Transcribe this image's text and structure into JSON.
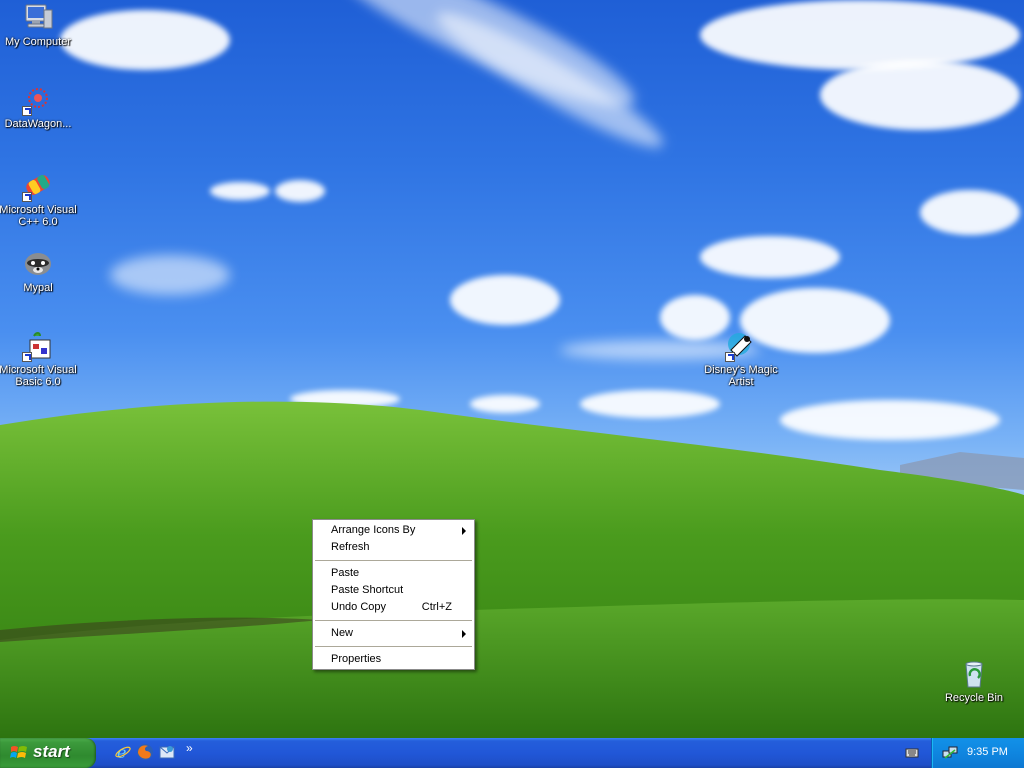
{
  "desktop_icons": [
    {
      "label": "My Computer",
      "icon": "my-computer-icon"
    },
    {
      "label": "DataWagon...",
      "icon": "datawagon-icon"
    },
    {
      "label": "Microsoft Visual C++ 6.0",
      "icon": "visual-cpp-icon"
    },
    {
      "label": "Mypal",
      "icon": "mypal-raccoon-icon"
    },
    {
      "label": "Microsoft Visual Basic 6.0",
      "icon": "visual-basic-icon"
    },
    {
      "label": "Disney's Magic Artist",
      "icon": "magic-artist-icon"
    },
    {
      "label": "Recycle Bin",
      "icon": "recycle-bin-icon"
    }
  ],
  "context_menu": {
    "arrange_icons_by": "Arrange Icons By",
    "refresh": "Refresh",
    "paste": "Paste",
    "paste_shortcut": "Paste Shortcut",
    "undo_copy": "Undo Copy",
    "undo_copy_shortcut": "Ctrl+Z",
    "new": "New",
    "properties": "Properties"
  },
  "taskbar": {
    "start_label": "start",
    "quick_launch": [
      "internet-explorer-icon",
      "firefox-icon",
      "outlook-express-icon"
    ],
    "overflow_chevron": "»",
    "clock": "9:35 PM"
  },
  "colors": {
    "taskbar_blue": "#245edb",
    "start_green": "#3c9a3c",
    "tray_blue": "#0f86e0"
  }
}
